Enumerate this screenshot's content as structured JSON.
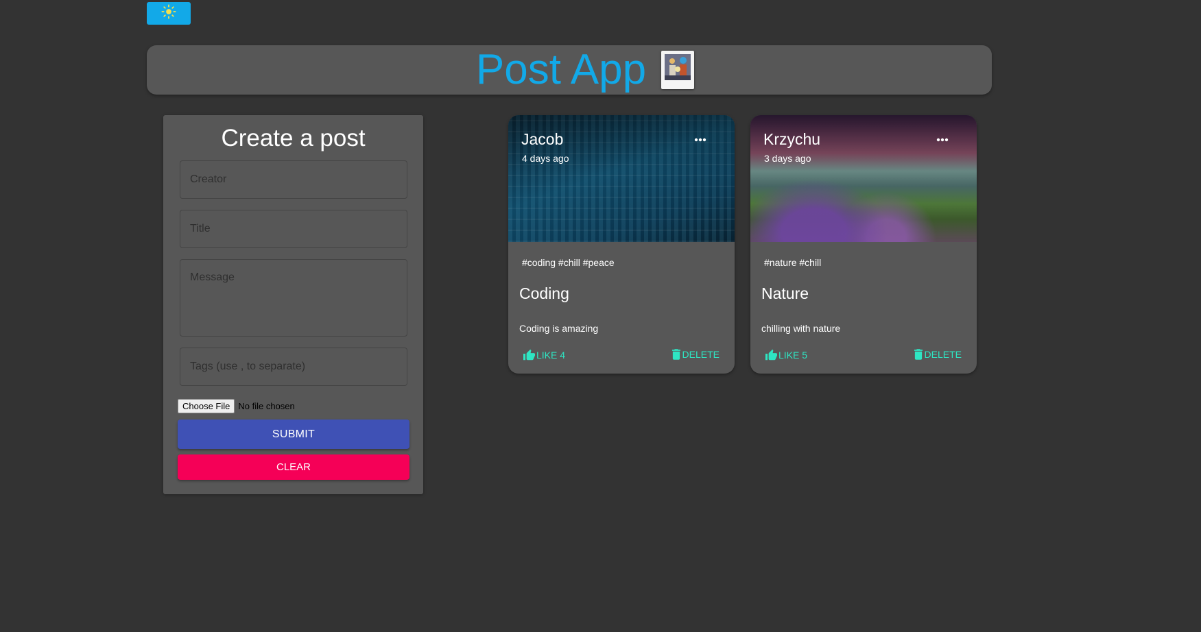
{
  "theme_toggle": {
    "icon": "sun-icon",
    "color": "#12a9e8"
  },
  "app_bar": {
    "title": "Post App",
    "logo_icon": "polaroid-photo-icon",
    "title_color": "#12a9e8"
  },
  "form": {
    "heading": "Create a post",
    "creator_placeholder": "Creator",
    "title_placeholder": "Title",
    "message_placeholder": "Message",
    "tags_placeholder": "Tags (use , to separate)",
    "file_button": "Choose File",
    "file_status": "No file chosen",
    "submit_label": "SUBMIT",
    "clear_label": "CLEAR",
    "submit_color": "#3f51b5",
    "clear_color": "#f50057"
  },
  "posts": [
    {
      "creator": "Jacob",
      "time": "4 days ago",
      "tags": "#coding #chill #peace",
      "title": "Coding",
      "message": "Coding is amazing",
      "like_label": "LIKE 4",
      "delete_label": "DELETE",
      "image_subject": "code-screen"
    },
    {
      "creator": "Krzychu",
      "time": "3 days ago",
      "tags": "#nature #chill",
      "title": "Nature",
      "message": "chilling with nature",
      "like_label": "LIKE 5",
      "delete_label": "DELETE",
      "image_subject": "lake-landscape"
    }
  ],
  "accent_color": "#2ee6c3"
}
